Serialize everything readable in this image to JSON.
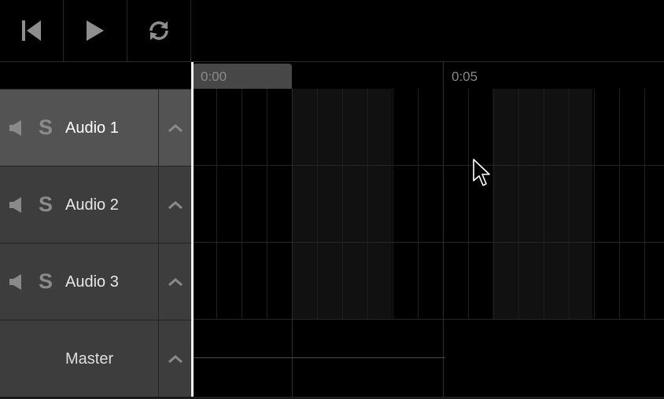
{
  "transport": {
    "rewind_icon": "skip-to-start-icon",
    "play_icon": "play-icon",
    "loop_icon": "loop-icon"
  },
  "ruler": {
    "labels": [
      "0:00",
      "0:05"
    ]
  },
  "tracks": [
    {
      "name": "Audio 1",
      "solo_label": "S",
      "selected": true
    },
    {
      "name": "Audio 2",
      "solo_label": "S",
      "selected": false
    },
    {
      "name": "Audio 3",
      "solo_label": "S",
      "selected": false
    }
  ],
  "master": {
    "name": "Master"
  },
  "colors": {
    "background": "#000000",
    "track_header": "#3d3d3d",
    "track_header_selected": "#535353",
    "playhead": "#f2f2f2"
  }
}
